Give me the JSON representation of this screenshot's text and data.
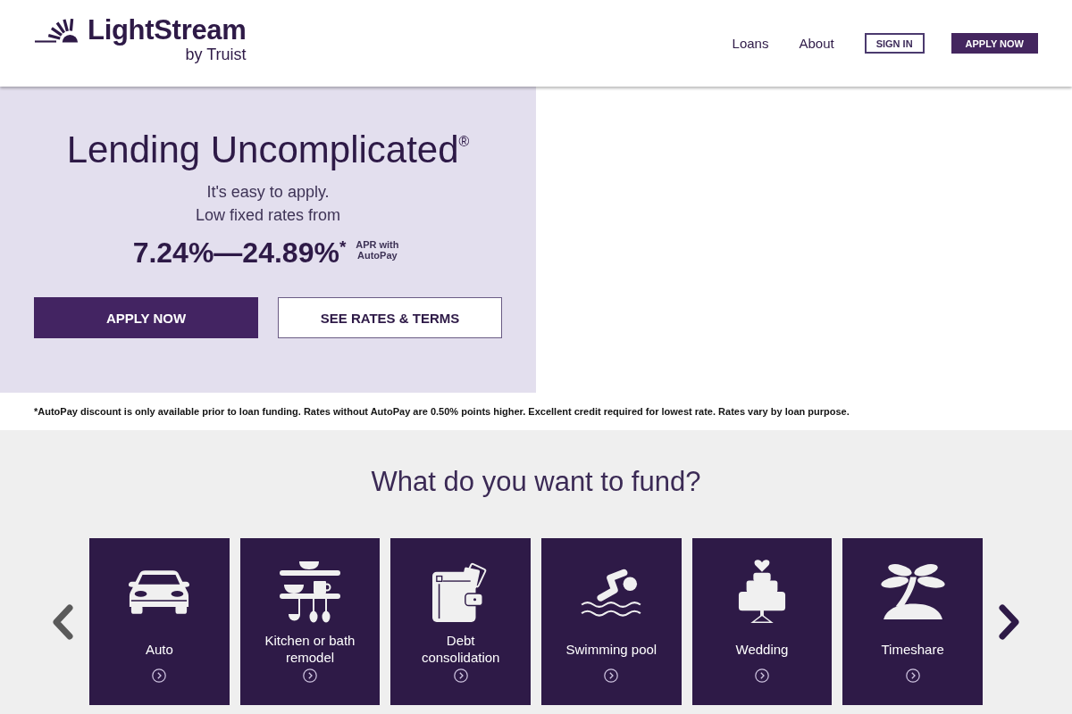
{
  "header": {
    "logo": {
      "name": "LightStream",
      "tagline": "by Truist"
    },
    "nav": [
      {
        "label": "Loans",
        "kind": "link"
      },
      {
        "label": "About",
        "kind": "link"
      },
      {
        "label": "SIGN IN",
        "kind": "outline"
      },
      {
        "label": "APPLY NOW",
        "kind": "filled"
      }
    ]
  },
  "hero": {
    "title": "Lending Uncomplicated$^{®}$",
    "lines": [
      "It's easy to apply.",
      "Low fixed rates from"
    ],
    "rate": "7.24%—24.89%$^{*}$",
    "rate_note": "APR with AutoPay",
    "buttons": [
      {
        "label": "APPLY NOW",
        "kind": "filled"
      },
      {
        "label": "SEE RATES & TERMS",
        "kind": "outline"
      }
    ]
  },
  "disclaimer": "*AutoPay discount is only available prior to loan funding. Rates without AutoPay are 0.50% points higher. Excellent credit required for lowest rate. Rates vary by loan purpose.",
  "fund": {
    "heading": "What do you want to fund?",
    "carousel": {
      "previous": {
        "disabled": true
      },
      "next": {
        "disabled": false
      }
    },
    "items": [
      {
        "label": "Auto"
      },
      {
        "label": "Kitchen or bath remodel"
      },
      {
        "label": "Debt consolidation"
      },
      {
        "label": "Swimming pool"
      },
      {
        "label": "Wedding"
      },
      {
        "label": "Timeshare"
      }
    ]
  }
}
